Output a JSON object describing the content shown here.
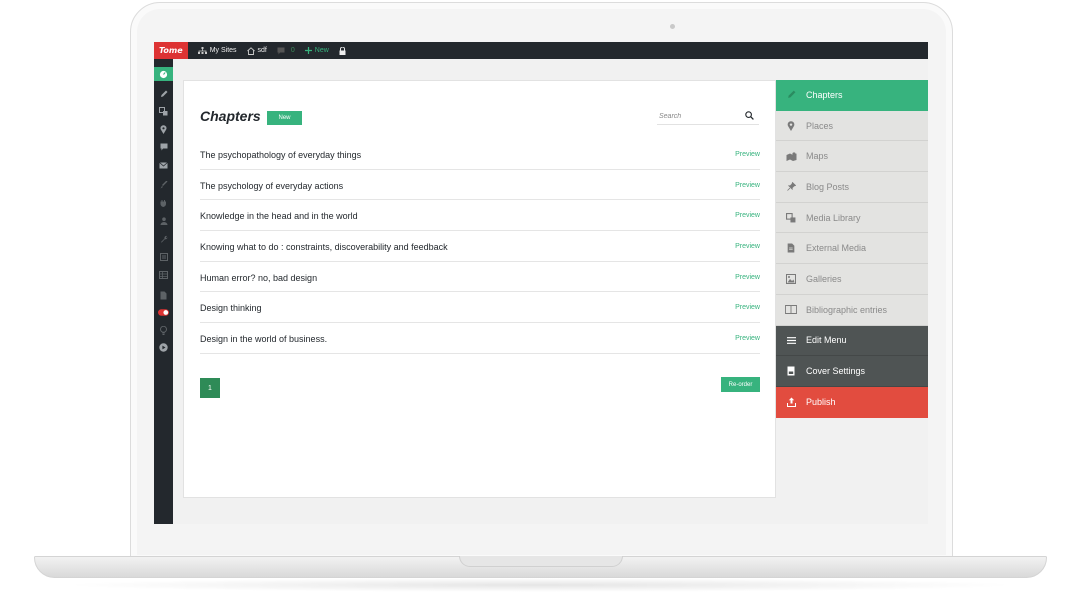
{
  "admin_bar": {
    "logo": "Tome",
    "my_sites": "My Sites",
    "site_name": "sdf",
    "comment_count": "0",
    "new_label": "New"
  },
  "page": {
    "title": "Chapters",
    "new_button": "New",
    "search_placeholder": "Search"
  },
  "chapters": [
    {
      "title": "The psychopathology of everyday things",
      "action": "Preview"
    },
    {
      "title": "The psychology of everyday actions",
      "action": "Preview"
    },
    {
      "title": "Knowledge in the head and in the world",
      "action": "Preview"
    },
    {
      "title": "Knowing what to do : constraints, discoverability and feedback",
      "action": "Preview"
    },
    {
      "title": "Human error? no, bad design",
      "action": "Preview"
    },
    {
      "title": "Design thinking",
      "action": "Preview"
    },
    {
      "title": "Design in the world of business.",
      "action": "Preview"
    }
  ],
  "pagination": {
    "current_page": "1"
  },
  "reorder_button": "Re-order",
  "book_menu": [
    {
      "label": "Chapters",
      "icon": "pencil-icon",
      "state": "active"
    },
    {
      "label": "Places",
      "icon": "map-pin-icon",
      "state": "normal"
    },
    {
      "label": "Maps",
      "icon": "map-icon",
      "state": "normal"
    },
    {
      "label": "Blog Posts",
      "icon": "pushpin-icon",
      "state": "normal"
    },
    {
      "label": "Media Library",
      "icon": "media-icon",
      "state": "normal"
    },
    {
      "label": "External Media",
      "icon": "document-icon",
      "state": "normal"
    },
    {
      "label": "Galleries",
      "icon": "gallery-icon",
      "state": "normal"
    },
    {
      "label": "Bibliographic entries",
      "icon": "book-icon",
      "state": "normal"
    },
    {
      "label": "Edit Menu",
      "icon": "hamburger-icon",
      "state": "dark"
    },
    {
      "label": "Cover Settings",
      "icon": "cover-icon",
      "state": "dark"
    },
    {
      "label": "Publish",
      "icon": "upload-icon",
      "state": "publish"
    }
  ],
  "colors": {
    "accent": "#37b37e",
    "admin_dark": "#23282d",
    "publish_red": "#e24c3f",
    "menu_dark": "#4f5454"
  }
}
